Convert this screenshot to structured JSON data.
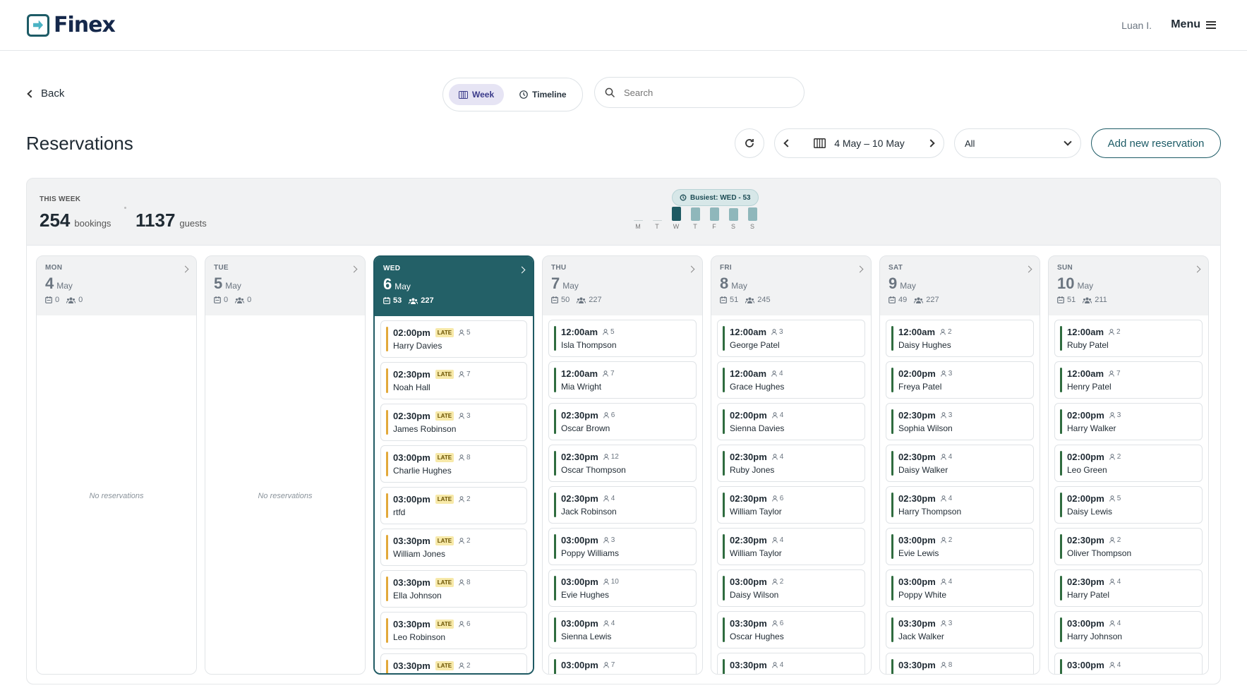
{
  "app": {
    "brand": "Finex",
    "user": "Luan I.",
    "menu_label": "Menu"
  },
  "nav": {
    "back_label": "Back"
  },
  "view": {
    "week_label": "Week",
    "timeline_label": "Timeline"
  },
  "search": {
    "placeholder": "Search"
  },
  "page": {
    "title": "Reservations"
  },
  "toolbar": {
    "date_range": "4 May – 10 May",
    "filter_value": "All",
    "add_label": "Add new reservation"
  },
  "summary": {
    "label": "THIS WEEK",
    "bookings": "254",
    "bookings_unit": "bookings",
    "guests": "1137",
    "guests_unit": "guests",
    "busiest": "Busiest: WED - 53",
    "mini_days": [
      "M",
      "T",
      "W",
      "T",
      "F",
      "S",
      "S"
    ],
    "mini_values": [
      0,
      0,
      53,
      50,
      51,
      49,
      51
    ]
  },
  "empty_text": "No reservations",
  "late_label": "LATE",
  "colors": {
    "accent": "#1f5a63",
    "late": "#e2a93a",
    "ontime": "#2f6c3f"
  },
  "days": [
    {
      "name": "MON",
      "num": "4",
      "month": "May",
      "bookings": "0",
      "guests": "0",
      "reservations": []
    },
    {
      "name": "TUE",
      "num": "5",
      "month": "May",
      "bookings": "0",
      "guests": "0",
      "reservations": []
    },
    {
      "name": "WED",
      "num": "6",
      "month": "May",
      "bookings": "53",
      "guests": "227",
      "selected": true,
      "reservations": [
        {
          "time": "02:00pm",
          "late": true,
          "guests": "5",
          "name": "Harry Davies"
        },
        {
          "time": "02:30pm",
          "late": true,
          "guests": "7",
          "name": "Noah Hall"
        },
        {
          "time": "02:30pm",
          "late": true,
          "guests": "3",
          "name": "James Robinson"
        },
        {
          "time": "03:00pm",
          "late": true,
          "guests": "8",
          "name": "Charlie Hughes"
        },
        {
          "time": "03:00pm",
          "late": true,
          "guests": "2",
          "name": "rtfd"
        },
        {
          "time": "03:30pm",
          "late": true,
          "guests": "2",
          "name": "William Jones"
        },
        {
          "time": "03:30pm",
          "late": true,
          "guests": "8",
          "name": "Ella Johnson"
        },
        {
          "time": "03:30pm",
          "late": true,
          "guests": "6",
          "name": "Leo Robinson"
        },
        {
          "time": "03:30pm",
          "late": true,
          "guests": "2",
          "name": ""
        }
      ]
    },
    {
      "name": "THU",
      "num": "7",
      "month": "May",
      "bookings": "50",
      "guests": "227",
      "reservations": [
        {
          "time": "12:00am",
          "late": false,
          "guests": "5",
          "name": "Isla Thompson"
        },
        {
          "time": "12:00am",
          "late": false,
          "guests": "7",
          "name": "Mia Wright"
        },
        {
          "time": "02:30pm",
          "late": false,
          "guests": "6",
          "name": "Oscar Brown"
        },
        {
          "time": "02:30pm",
          "late": false,
          "guests": "12",
          "name": "Oscar Thompson"
        },
        {
          "time": "02:30pm",
          "late": false,
          "guests": "4",
          "name": "Jack Robinson"
        },
        {
          "time": "03:00pm",
          "late": false,
          "guests": "3",
          "name": "Poppy Williams"
        },
        {
          "time": "03:00pm",
          "late": false,
          "guests": "10",
          "name": "Evie Hughes"
        },
        {
          "time": "03:00pm",
          "late": false,
          "guests": "4",
          "name": "Sienna Lewis"
        },
        {
          "time": "03:00pm",
          "late": false,
          "guests": "7",
          "name": ""
        }
      ]
    },
    {
      "name": "FRI",
      "num": "8",
      "month": "May",
      "bookings": "51",
      "guests": "245",
      "reservations": [
        {
          "time": "12:00am",
          "late": false,
          "guests": "3",
          "name": "George Patel"
        },
        {
          "time": "12:00am",
          "late": false,
          "guests": "4",
          "name": "Grace Hughes"
        },
        {
          "time": "02:00pm",
          "late": false,
          "guests": "4",
          "name": "Sienna Davies"
        },
        {
          "time": "02:30pm",
          "late": false,
          "guests": "4",
          "name": "Ruby Jones"
        },
        {
          "time": "02:30pm",
          "late": false,
          "guests": "6",
          "name": "William Taylor"
        },
        {
          "time": "02:30pm",
          "late": false,
          "guests": "4",
          "name": "William Taylor"
        },
        {
          "time": "03:00pm",
          "late": false,
          "guests": "2",
          "name": "Daisy Wilson"
        },
        {
          "time": "03:30pm",
          "late": false,
          "guests": "6",
          "name": "Oscar Hughes"
        },
        {
          "time": "03:30pm",
          "late": false,
          "guests": "4",
          "name": ""
        }
      ]
    },
    {
      "name": "SAT",
      "num": "9",
      "month": "May",
      "bookings": "49",
      "guests": "227",
      "reservations": [
        {
          "time": "12:00am",
          "late": false,
          "guests": "2",
          "name": "Daisy Hughes"
        },
        {
          "time": "02:00pm",
          "late": false,
          "guests": "3",
          "name": "Freya Patel"
        },
        {
          "time": "02:30pm",
          "late": false,
          "guests": "3",
          "name": "Sophia Wilson"
        },
        {
          "time": "02:30pm",
          "late": false,
          "guests": "4",
          "name": "Daisy Walker"
        },
        {
          "time": "02:30pm",
          "late": false,
          "guests": "4",
          "name": "Harry Thompson"
        },
        {
          "time": "03:00pm",
          "late": false,
          "guests": "2",
          "name": "Evie Lewis"
        },
        {
          "time": "03:00pm",
          "late": false,
          "guests": "4",
          "name": "Poppy White"
        },
        {
          "time": "03:30pm",
          "late": false,
          "guests": "3",
          "name": "Jack Walker"
        },
        {
          "time": "03:30pm",
          "late": false,
          "guests": "8",
          "name": ""
        }
      ]
    },
    {
      "name": "SUN",
      "num": "10",
      "month": "May",
      "bookings": "51",
      "guests": "211",
      "reservations": [
        {
          "time": "12:00am",
          "late": false,
          "guests": "2",
          "name": "Ruby Patel"
        },
        {
          "time": "12:00am",
          "late": false,
          "guests": "7",
          "name": "Henry Patel"
        },
        {
          "time": "02:00pm",
          "late": false,
          "guests": "3",
          "name": "Harry Walker"
        },
        {
          "time": "02:00pm",
          "late": false,
          "guests": "2",
          "name": "Leo Green"
        },
        {
          "time": "02:00pm",
          "late": false,
          "guests": "5",
          "name": "Daisy Lewis"
        },
        {
          "time": "02:30pm",
          "late": false,
          "guests": "2",
          "name": "Oliver Thompson"
        },
        {
          "time": "02:30pm",
          "late": false,
          "guests": "4",
          "name": "Harry Patel"
        },
        {
          "time": "03:00pm",
          "late": false,
          "guests": "4",
          "name": "Harry Johnson"
        },
        {
          "time": "03:00pm",
          "late": false,
          "guests": "4",
          "name": ""
        }
      ]
    }
  ]
}
